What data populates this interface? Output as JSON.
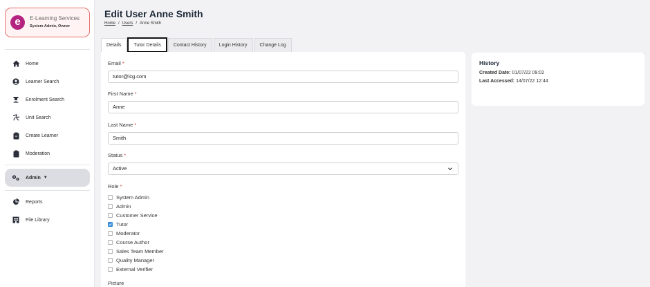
{
  "org": {
    "logo_letter": "e",
    "name": "E-Learning Services",
    "role": "System Admin, Owner",
    "accent": "#b3237f"
  },
  "nav": {
    "items": [
      {
        "label": "Home",
        "icon": "home-icon"
      },
      {
        "label": "Learner Search",
        "icon": "user-circle-icon"
      },
      {
        "label": "Enrolment Search",
        "icon": "graduation-cap-icon"
      },
      {
        "label": "Unit Search",
        "icon": "unit-icon"
      },
      {
        "label": "Create Learner",
        "icon": "clipboard-plus-icon"
      },
      {
        "label": "Moderation",
        "icon": "clipboard-icon"
      },
      {
        "label": "Admin",
        "icon": "cogs-icon"
      },
      {
        "label": "Reports",
        "icon": "pie-chart-icon"
      },
      {
        "label": "File Library",
        "icon": "building-icon"
      }
    ]
  },
  "header": {
    "title": "Edit User Anne Smith",
    "breadcrumb": [
      "Home",
      "Users",
      "Anne Smith"
    ]
  },
  "tabs": [
    "Details",
    "Tutor Details",
    "Contact History",
    "Login History",
    "Change Log"
  ],
  "form": {
    "email_label": "Email",
    "email_value": "tutor@lcg.com",
    "first_name_label": "First Name",
    "first_name_value": "Anne",
    "last_name_label": "Last Name",
    "last_name_value": "Smith",
    "status_label": "Status",
    "status_value": "Active",
    "role_label": "Role",
    "roles": [
      {
        "label": "System Admin",
        "checked": false
      },
      {
        "label": "Admin",
        "checked": false
      },
      {
        "label": "Customer Service",
        "checked": false
      },
      {
        "label": "Tutor",
        "checked": true
      },
      {
        "label": "Moderator",
        "checked": false
      },
      {
        "label": "Course Author",
        "checked": false
      },
      {
        "label": "Sales Team Member",
        "checked": false
      },
      {
        "label": "Quality Manager",
        "checked": false
      },
      {
        "label": "External Verifier",
        "checked": false
      }
    ],
    "picture_label": "Picture",
    "required_marker": "*"
  },
  "history": {
    "title": "History",
    "created_label": "Created Date:",
    "created_value": "01/07/22 09:02",
    "accessed_label": "Last Accessed:",
    "accessed_value": "14/07/22 12:44"
  }
}
